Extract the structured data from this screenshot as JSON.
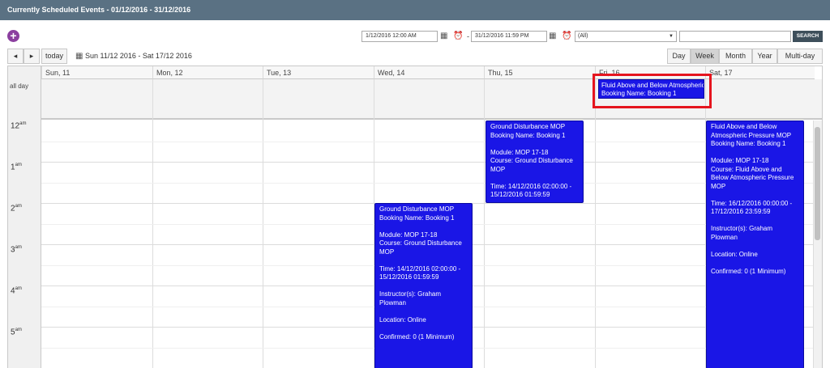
{
  "window": {
    "title": "Currently Scheduled Events - 01/12/2016 - 31/12/2016"
  },
  "filters": {
    "start_datetime": "1/12/2016 12:00 AM",
    "end_datetime": "31/12/2016 11:59 PM",
    "category_select": "(All)",
    "search_value": "",
    "search_label": "SEARCH"
  },
  "toolbar": {
    "prev": "◂",
    "next": "▸",
    "today": "today",
    "range": "Sun 11/12 2016 - Sat 17/12 2016",
    "views": [
      "Day",
      "Week",
      "Month",
      "Year",
      "Multi-day"
    ],
    "active_view": "Week"
  },
  "calendar": {
    "days": [
      "Sun, 11",
      "Mon, 12",
      "Tue, 13",
      "Wed, 14",
      "Thu, 15",
      "Fri, 16",
      "Sat, 17"
    ],
    "all_day_label": "all day",
    "hours": [
      {
        "h": "12",
        "ap": "am"
      },
      {
        "h": "1",
        "ap": "am"
      },
      {
        "h": "2",
        "ap": "am"
      },
      {
        "h": "3",
        "ap": "am"
      },
      {
        "h": "4",
        "ap": "am"
      },
      {
        "h": "5",
        "ap": "am"
      }
    ]
  },
  "all_day_event": {
    "title": "Fluid Above and Below Atmospheric Pressure MOP",
    "booking": "Booking Name: Booking 1"
  },
  "events": {
    "thu": {
      "title": "Ground Disturbance MOP",
      "booking": "Booking Name: Booking 1",
      "module": "Module: MOP 17-18",
      "course": "Course: Ground Disturbance MOP",
      "time": "Time: 14/12/2016 02:00:00 - 15/12/2016 01:59:59"
    },
    "wed": {
      "title": "Ground Disturbance MOP",
      "booking": "Booking Name: Booking 1",
      "module": "Module: MOP 17-18",
      "course": "Course: Ground Disturbance MOP",
      "time": "Time: 14/12/2016 02:00:00 - 15/12/2016 01:59:59",
      "instructor": "Instructor(s): Graham Plowman",
      "location": "Location: Online",
      "confirmed": "Confirmed: 0 (1 Minimum)"
    },
    "sat": {
      "title": "Fluid Above and Below Atmospheric Pressure MOP",
      "booking": "Booking Name: Booking 1",
      "module": "Module: MOP 17-18",
      "course": "Course: Fluid Above and Below Atmospheric Pressure MOP",
      "time": "Time: 16/12/2016 00:00:00 - 17/12/2016 23:59:59",
      "instructor": "Instructor(s): Graham Plowman",
      "location": "Location: Online",
      "confirmed": "Confirmed: 0 (1 Minimum)"
    }
  },
  "colors": {
    "event": "#1a16e6",
    "header": "#5a7183",
    "highlight": "#e5151e",
    "add": "#8b3f9f"
  }
}
